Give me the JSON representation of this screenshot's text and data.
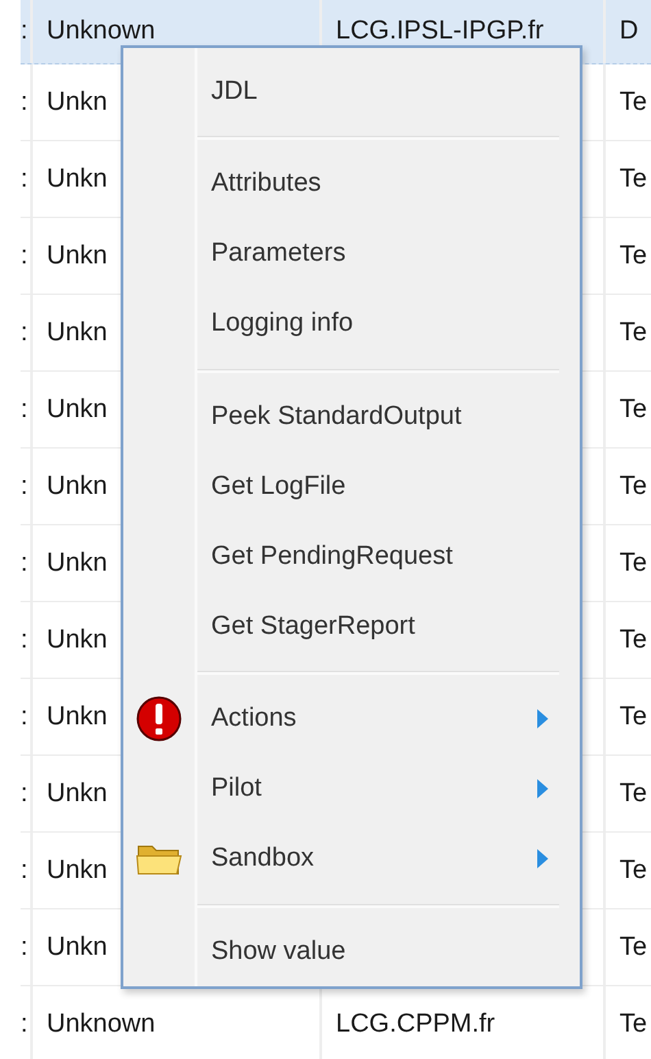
{
  "table": {
    "rows": [
      {
        "selected": true,
        "cells": [
          ":",
          "Unknown",
          "LCG.IPSL-IPGP.fr",
          "D"
        ]
      },
      {
        "selected": false,
        "cells": [
          ":",
          "Unkn",
          "",
          "Te"
        ]
      },
      {
        "selected": false,
        "cells": [
          ":",
          "Unkn",
          "",
          "Te"
        ]
      },
      {
        "selected": false,
        "cells": [
          ":",
          "Unkn",
          "",
          "Te"
        ]
      },
      {
        "selected": false,
        "cells": [
          ":",
          "Unkn",
          "",
          "Te"
        ]
      },
      {
        "selected": false,
        "cells": [
          ":",
          "Unkn",
          "",
          "Te"
        ]
      },
      {
        "selected": false,
        "cells": [
          ":",
          "Unkn",
          "",
          "Te"
        ]
      },
      {
        "selected": false,
        "cells": [
          ":",
          "Unkn",
          "",
          "Te"
        ]
      },
      {
        "selected": false,
        "cells": [
          ":",
          "Unkn",
          "",
          "Te"
        ]
      },
      {
        "selected": false,
        "cells": [
          ":",
          "Unkn",
          "",
          "Te"
        ]
      },
      {
        "selected": false,
        "cells": [
          ":",
          "Unkn",
          "",
          "Te"
        ]
      },
      {
        "selected": false,
        "cells": [
          ":",
          "Unkn",
          "",
          "Te"
        ]
      },
      {
        "selected": false,
        "cells": [
          ":",
          "Unkn",
          "",
          "Te"
        ]
      },
      {
        "selected": false,
        "cells": [
          ":",
          "Unknown",
          "LCG.CPPM.fr",
          "Te"
        ]
      }
    ]
  },
  "context_menu": {
    "items": [
      {
        "kind": "item",
        "label": "JDL"
      },
      {
        "kind": "separator"
      },
      {
        "kind": "item",
        "label": "Attributes"
      },
      {
        "kind": "item",
        "label": "Parameters"
      },
      {
        "kind": "item",
        "label": "Logging info"
      },
      {
        "kind": "separator"
      },
      {
        "kind": "item",
        "label": "Peek StandardOutput"
      },
      {
        "kind": "item",
        "label": "Get LogFile"
      },
      {
        "kind": "item",
        "label": "Get PendingRequest"
      },
      {
        "kind": "item",
        "label": "Get StagerReport"
      },
      {
        "kind": "separator"
      },
      {
        "kind": "alert",
        "label": "Actions",
        "submenu": true
      },
      {
        "kind": "item",
        "label": "Pilot",
        "submenu": true
      },
      {
        "kind": "folder",
        "label": "Sandbox",
        "submenu": true
      },
      {
        "kind": "separator"
      },
      {
        "kind": "item",
        "label": "Show value"
      }
    ]
  }
}
